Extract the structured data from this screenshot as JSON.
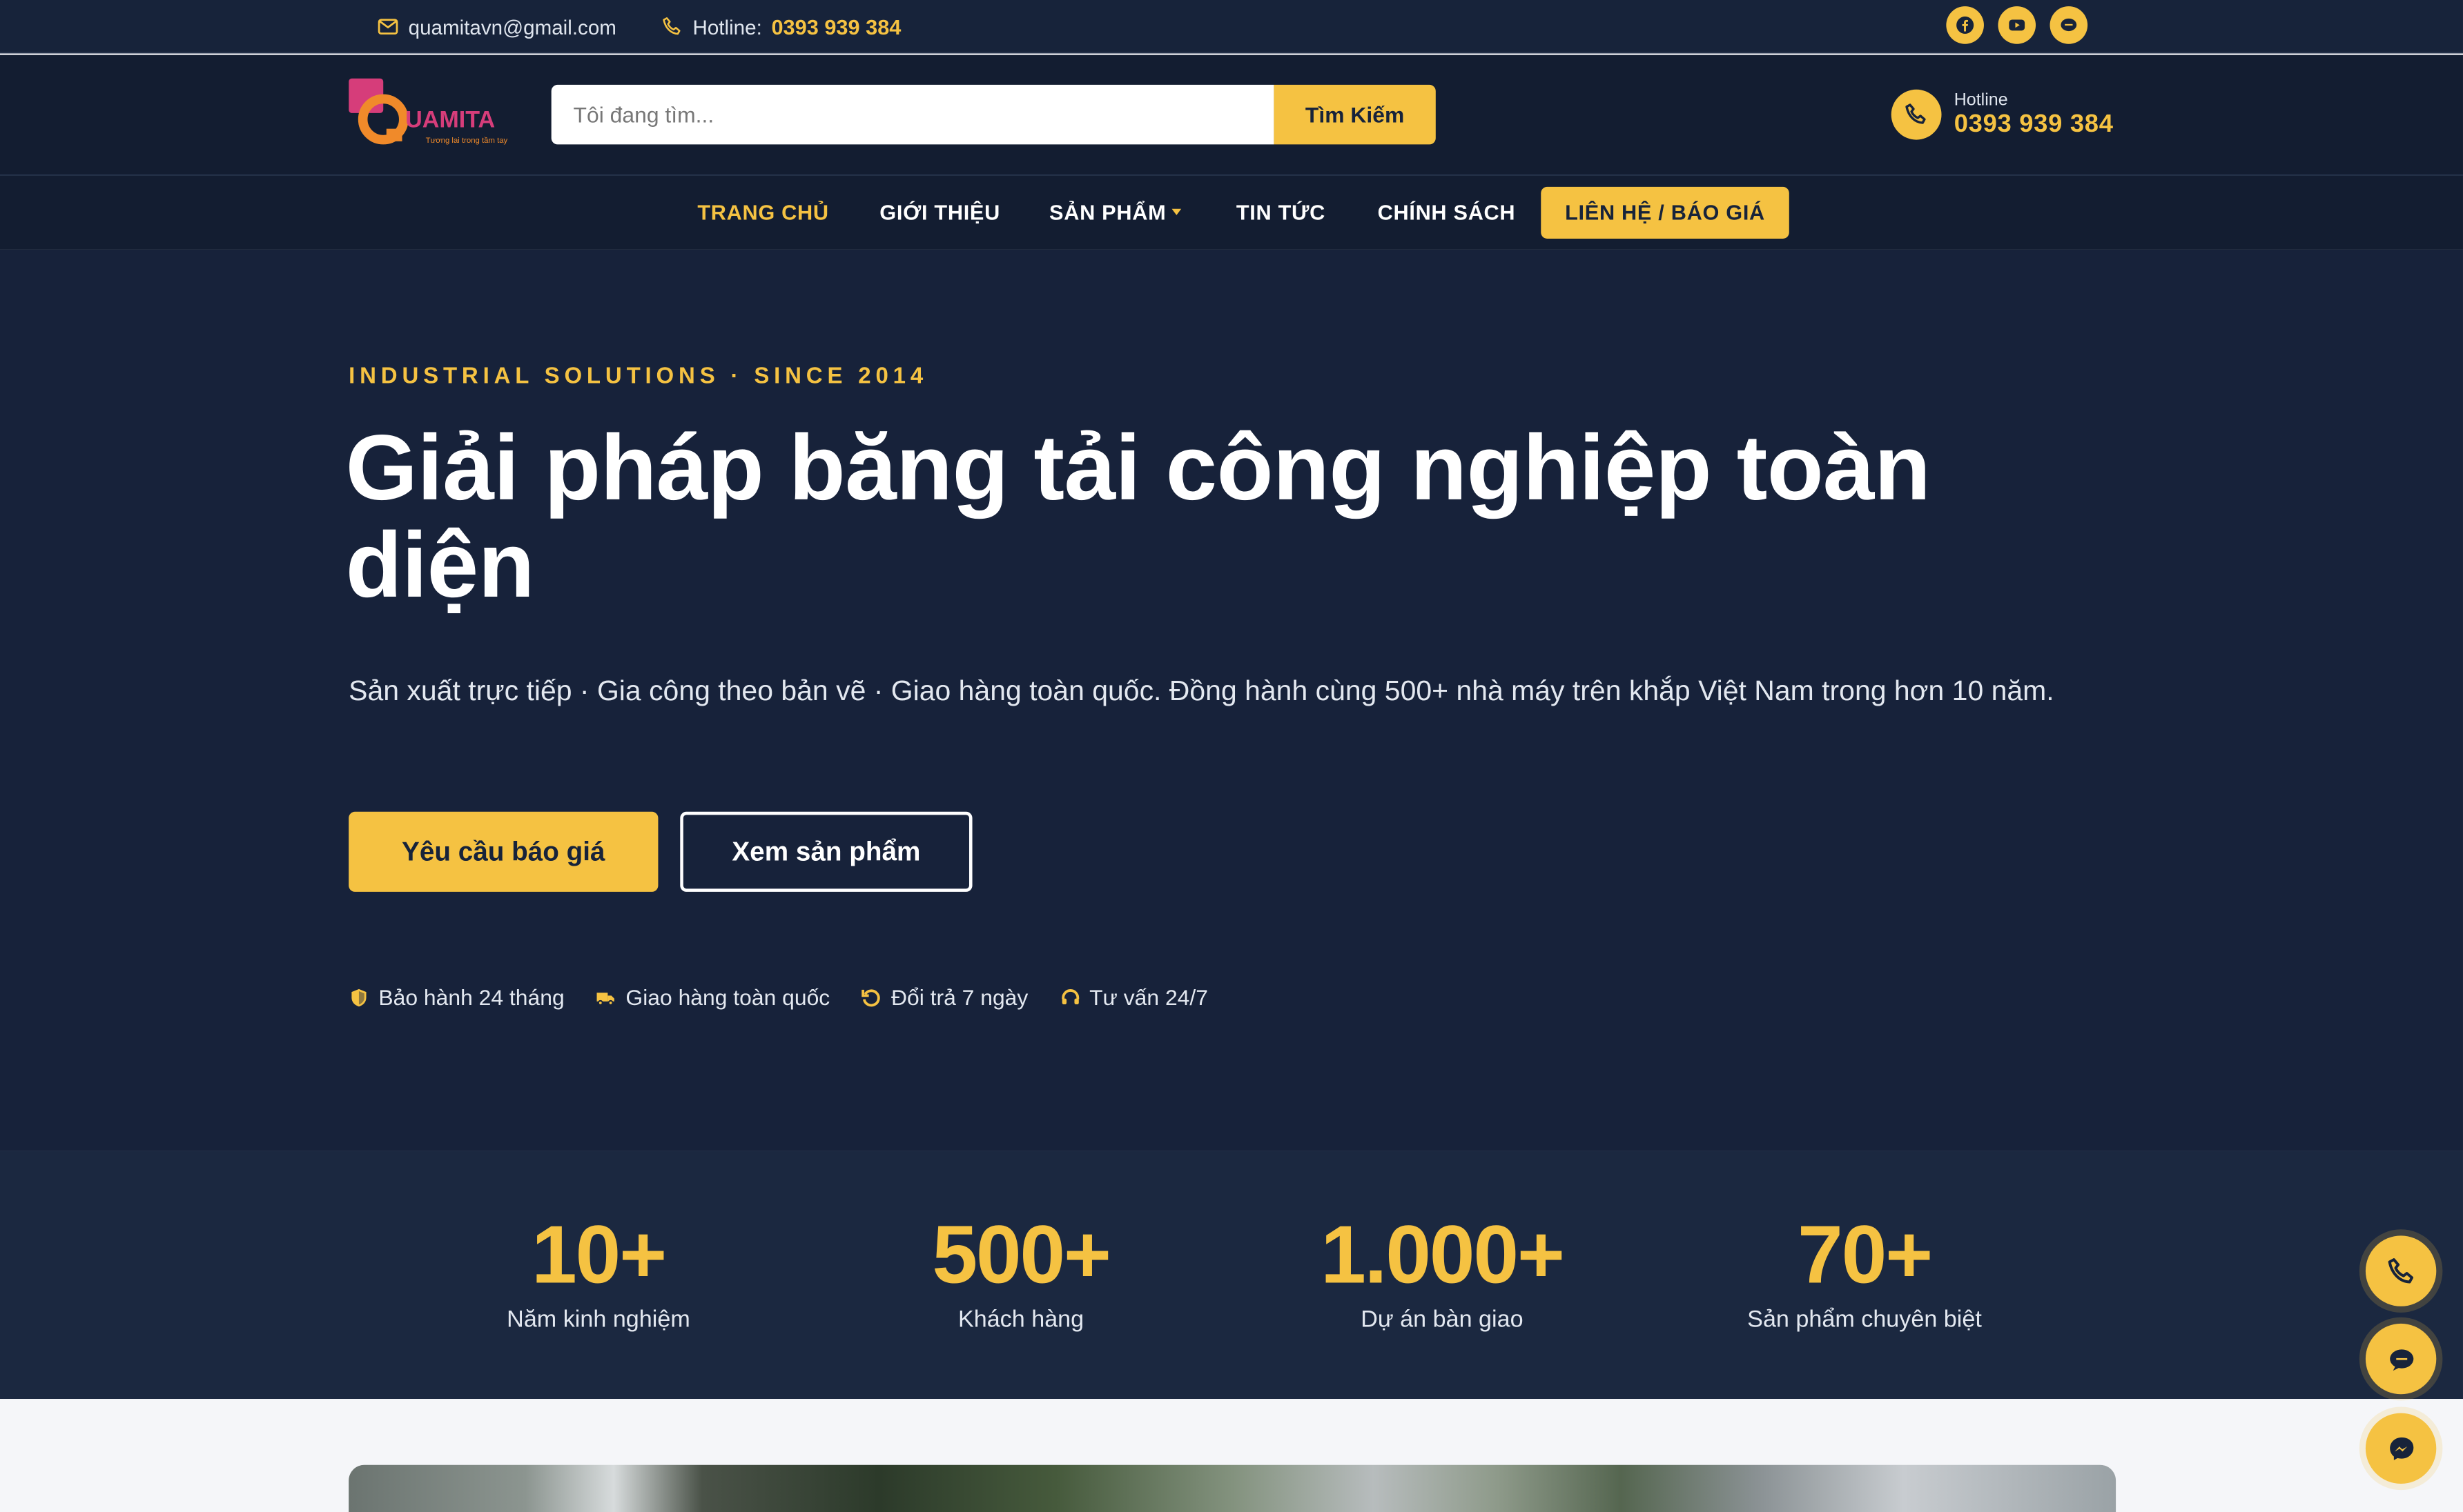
{
  "topbar": {
    "email": "quamitavn@gmail.com",
    "hotline_label": "Hotline:",
    "hotline_number": "0393 939 384",
    "socials": [
      "facebook-icon",
      "youtube-icon",
      "chat-icon"
    ]
  },
  "header": {
    "logo_text": "UAMITA",
    "logo_tagline": "Tương lai trong tầm tay",
    "search_placeholder": "Tôi đang tìm...",
    "search_button": "Tìm Kiếm",
    "hotline_label": "Hotline",
    "hotline_number": "0393 939 384"
  },
  "nav": {
    "items": [
      "TRANG CHỦ",
      "GIỚI THIỆU",
      "SẢN PHẨM",
      "TIN TỨC",
      "CHÍNH SÁCH"
    ],
    "cta": "LIÊN HỆ / BÁO GIÁ"
  },
  "hero": {
    "eyebrow": "INDUSTRIAL SOLUTIONS · SINCE 2014",
    "title": "Giải pháp băng tải công nghiệp toàn diện",
    "lead": "Sản xuất trực tiếp · Gia công theo bản vẽ · Giao hàng toàn quốc. Đồng hành cùng 500+ nhà máy trên khắp Việt Nam trong hơn 10 năm.",
    "primary_button": "Yêu cầu báo giá",
    "secondary_button": "Xem sản phẩm",
    "badges": [
      "Bảo hành 24 tháng",
      "Giao hàng toàn quốc",
      "Đổi trả 7 ngày",
      "Tư vấn 24/7"
    ]
  },
  "stats": [
    {
      "value": "10+",
      "label": "Năm kinh nghiệm"
    },
    {
      "value": "500+",
      "label": "Khách hàng"
    },
    {
      "value": "1.000+",
      "label": "Dự án bàn giao"
    },
    {
      "value": "70+",
      "label": "Sản phẩm chuyên biệt"
    }
  ],
  "floating": [
    "phone-icon",
    "zalo-chat-icon",
    "messenger-icon"
  ],
  "colors": {
    "accent": "#f5c242",
    "navy": "#17223a",
    "stats_bg": "#1b2840"
  }
}
